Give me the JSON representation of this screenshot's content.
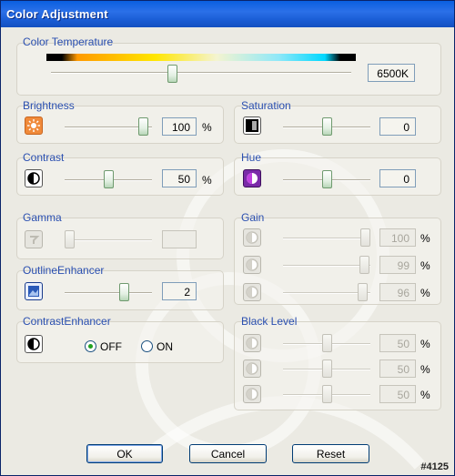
{
  "window": {
    "title": "Color Adjustment"
  },
  "color_temperature": {
    "label": "Color Temperature",
    "value": "6500K",
    "level": 0.4
  },
  "brightness": {
    "label": "Brightness",
    "value": "100",
    "unit": "%",
    "level": 0.95,
    "icon": "brightness-icon"
  },
  "saturation": {
    "label": "Saturation",
    "value": "0",
    "level": 0.5,
    "icon": "saturation-icon"
  },
  "contrast": {
    "label": "Contrast",
    "value": "50",
    "unit": "%",
    "level": 0.5,
    "icon": "contrast-icon"
  },
  "hue": {
    "label": "Hue",
    "value": "0",
    "level": 0.5,
    "icon": "hue-icon"
  },
  "gamma": {
    "label": "Gamma",
    "value": "",
    "level": 0.0,
    "icon": "gamma-icon",
    "enabled": false
  },
  "gain": {
    "label": "Gain",
    "channels": [
      {
        "value": "100",
        "unit": "%",
        "level": 1.0
      },
      {
        "value": "99",
        "unit": "%",
        "level": 0.99
      },
      {
        "value": "96",
        "unit": "%",
        "level": 0.96
      }
    ],
    "enabled": false
  },
  "outline_enhancer": {
    "label": "OutlineEnhancer",
    "value": "2",
    "level": 0.7,
    "icon": "outline-enhancer-icon"
  },
  "contrast_enhancer": {
    "label": "ContrastEnhancer",
    "off_label": "OFF",
    "on_label": "ON",
    "selected": "OFF"
  },
  "black_level": {
    "label": "Black Level",
    "channels": [
      {
        "value": "50",
        "unit": "%",
        "level": 0.5
      },
      {
        "value": "50",
        "unit": "%",
        "level": 0.5
      },
      {
        "value": "50",
        "unit": "%",
        "level": 0.5
      }
    ],
    "enabled": false
  },
  "buttons": {
    "ok": "OK",
    "cancel": "Cancel",
    "reset": "Reset"
  },
  "corner_tag": "#4125"
}
